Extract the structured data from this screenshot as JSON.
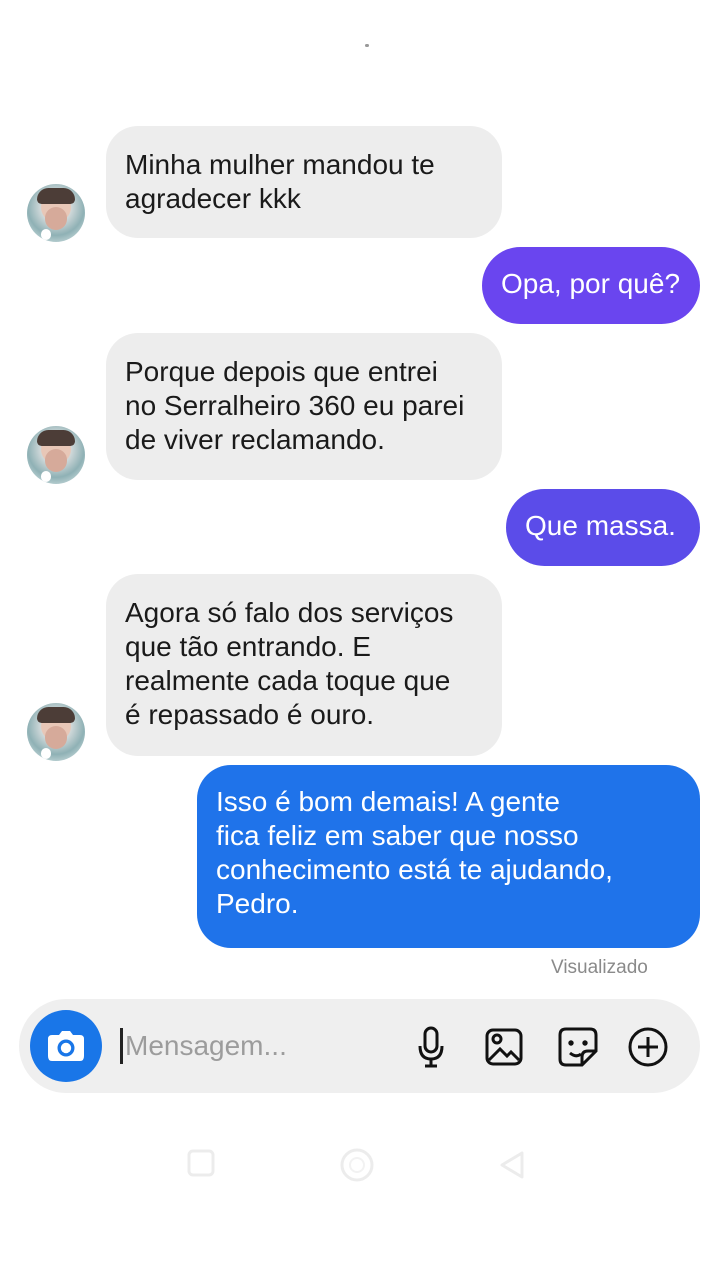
{
  "messages": [
    {
      "side": "incoming",
      "lines": [
        "Minha mulher mandou te",
        "agradecer kkk"
      ]
    },
    {
      "side": "outgoing",
      "lines": [
        "Opa, por quê?"
      ],
      "color": "#6a45ef"
    },
    {
      "side": "incoming",
      "lines": [
        "Porque depois que entrei",
        "no Serralheiro 360 eu parei",
        "de viver reclamando."
      ]
    },
    {
      "side": "outgoing",
      "lines": [
        "Que massa."
      ],
      "color": "#5b4ce9"
    },
    {
      "side": "incoming",
      "lines": [
        "Agora só falo dos serviços",
        "que tão entrando. E",
        "realmente cada toque que",
        "é repassado é ouro."
      ]
    },
    {
      "side": "outgoing",
      "lines": [
        "Isso é bom demais! A gente",
        "fica feliz em saber que nosso",
        "conhecimento está te ajudando,",
        "Pedro."
      ],
      "color": "#1f73ea"
    }
  ],
  "status": {
    "seen": "Visualizado"
  },
  "composer": {
    "placeholder": "Mensagem...",
    "camera_icon": "camera-icon",
    "tools": [
      "microphone-icon",
      "image-icon",
      "sticker-icon",
      "plus-circle-icon"
    ]
  },
  "colors": {
    "incoming_bubble": "#ededed",
    "camera_button": "#1976e8",
    "composer_background": "#efefef"
  },
  "navigation": {
    "icons": [
      "recent-apps-icon",
      "home-icon",
      "back-icon"
    ]
  }
}
